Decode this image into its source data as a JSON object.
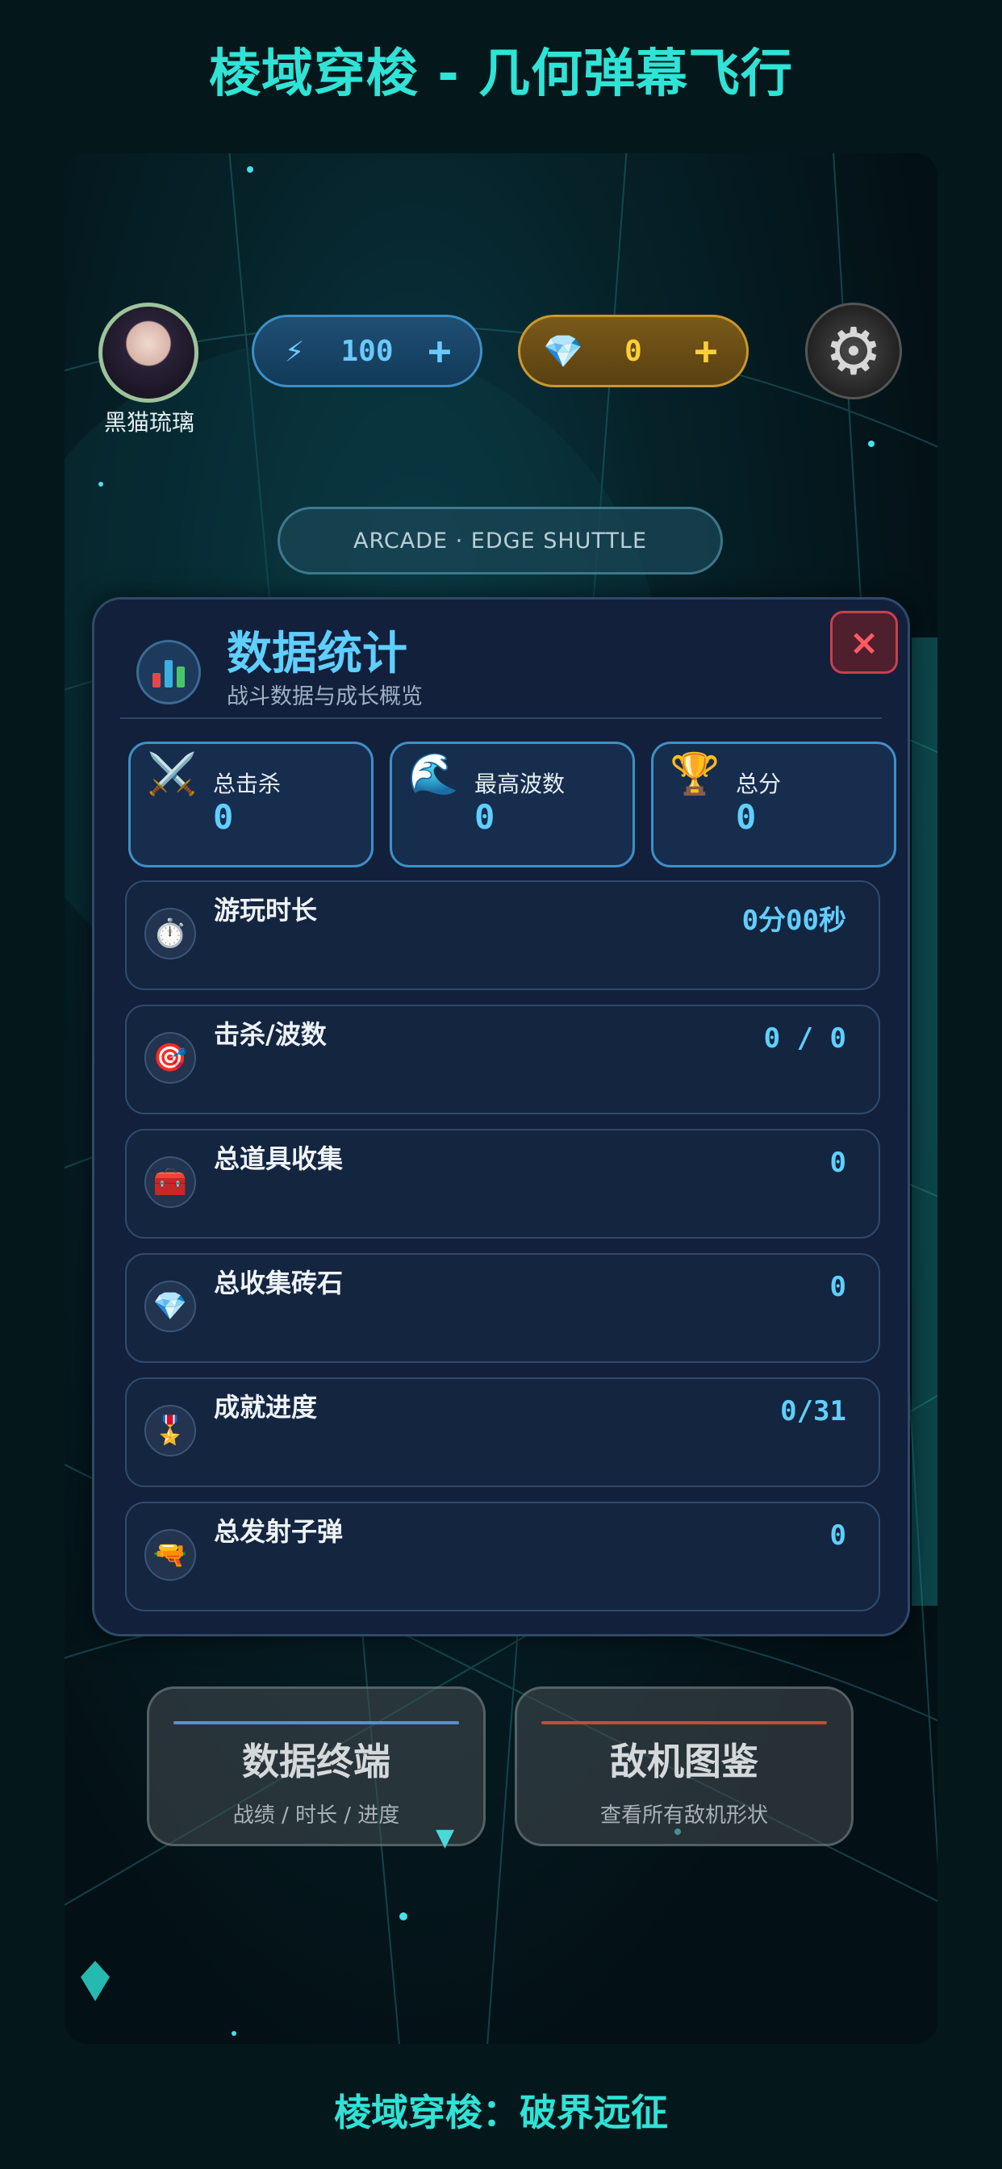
{
  "page": {
    "title": "棱域穿梭 - 几何弹幕飞行",
    "footer": "棱域穿梭：破界远征"
  },
  "hud": {
    "player_name": "黑猫琉璃",
    "energy": {
      "icon": "lightning-icon",
      "value": "100",
      "plus": "+"
    },
    "gems": {
      "icon": "diamond-icon",
      "value": "0",
      "plus": "+"
    },
    "settings_icon": "gear-icon"
  },
  "menu": {
    "mode_label": "ARCADE · EDGE SHUTTLE",
    "bg_title": "棱域穿梭",
    "buttons": [
      {
        "title": "数据终端",
        "subtitle": "战绩 / 时长 / 进度"
      },
      {
        "title": "敌机图鉴",
        "subtitle": "查看所有敌机形状"
      }
    ]
  },
  "modal": {
    "title": "数据统计",
    "subtitle": "战斗数据与成长概览",
    "close_label": "×",
    "summary": [
      {
        "icon": "⚔️",
        "label": "总击杀",
        "value": "0"
      },
      {
        "icon": "🌊",
        "label": "最高波数",
        "value": "0"
      },
      {
        "icon": "🏆",
        "label": "总分",
        "value": "0"
      }
    ],
    "rows": [
      {
        "icon": "⏱️",
        "label": "游玩时长",
        "value": "0分00秒"
      },
      {
        "icon": "🎯",
        "label": "击杀/波数",
        "value": "0 / 0"
      },
      {
        "icon": "🧰",
        "label": "总道具收集",
        "value": "0"
      },
      {
        "icon": "💎",
        "label": "总收集砖石",
        "value": "0"
      },
      {
        "icon": "🎖️",
        "label": "成就进度",
        "value": "0/31"
      },
      {
        "icon": "🔫",
        "label": "总发射子弹",
        "value": "0"
      }
    ]
  },
  "colors": {
    "accent": "#2fe3d6",
    "value_blue": "#5fcfff",
    "close_red": "#ff5a64"
  }
}
